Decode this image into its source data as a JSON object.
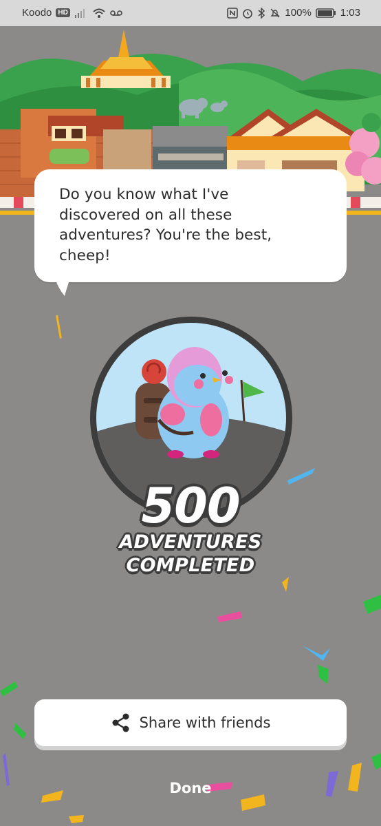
{
  "status_bar": {
    "carrier": "Koodo",
    "network_badge": "HD",
    "battery": "100%",
    "time": "1:03",
    "icons": [
      "signal-icon",
      "wifi-icon",
      "voicemail-icon",
      "nfc-icon",
      "alarm-icon",
      "bluetooth-icon",
      "mute-icon",
      "battery-icon"
    ]
  },
  "speech_bubble": {
    "line1": "Do you know what I've",
    "line2": "discovered on all these",
    "line3": "adventures? You're the best,",
    "line4": "cheep!"
  },
  "milestone": {
    "count": "500",
    "caption_line1": "ADVENTURES",
    "caption_line2": "COMPLETED"
  },
  "actions": {
    "share_label": "Share with friends",
    "share_icon": "share-icon",
    "done_label": "Done"
  },
  "colors": {
    "background": "#8c8a88",
    "sky_badge": "#bfe4f7",
    "bird_body": "#8ec9f2",
    "bird_head": "#e49bd8",
    "outline": "#3c3c3c"
  }
}
